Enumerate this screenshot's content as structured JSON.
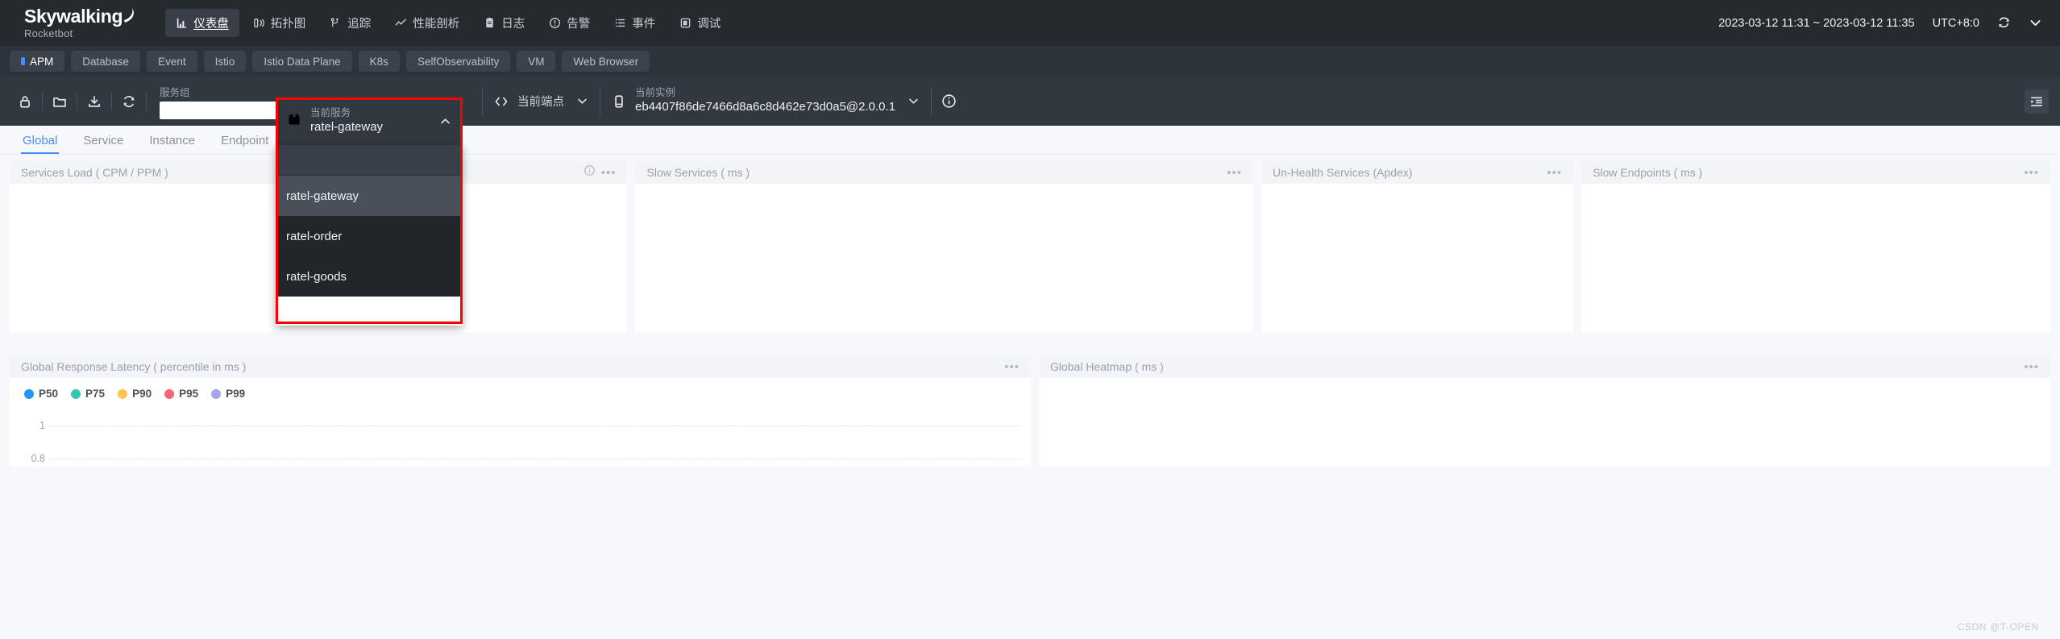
{
  "header": {
    "brand_name": "Skywalking",
    "brand_sub": "Rocketbot",
    "nav": [
      {
        "label": "仪表盘",
        "icon": "dashboard-icon",
        "active": true
      },
      {
        "label": "拓扑图",
        "icon": "topology-icon",
        "active": false
      },
      {
        "label": "追踪",
        "icon": "trace-icon",
        "active": false
      },
      {
        "label": "性能剖析",
        "icon": "profiling-icon",
        "active": false
      },
      {
        "label": "日志",
        "icon": "log-icon",
        "active": false
      },
      {
        "label": "告警",
        "icon": "alarm-icon",
        "active": false
      },
      {
        "label": "事件",
        "icon": "event-icon",
        "active": false
      },
      {
        "label": "调试",
        "icon": "debug-icon",
        "active": false
      }
    ],
    "time_range": "2023-03-12 11:31 ~ 2023-03-12 11:35",
    "timezone": "UTC+8:0",
    "reload_icon": "refresh-icon",
    "expand_icon": "chevron-down-icon"
  },
  "subnav": {
    "items": [
      {
        "label": "APM",
        "active": true
      },
      {
        "label": "Database",
        "active": false
      },
      {
        "label": "Event",
        "active": false
      },
      {
        "label": "Istio",
        "active": false
      },
      {
        "label": "Istio Data Plane",
        "active": false
      },
      {
        "label": "K8s",
        "active": false
      },
      {
        "label": "SelfObservability",
        "active": false
      },
      {
        "label": "VM",
        "active": false
      },
      {
        "label": "Web Browser",
        "active": false
      }
    ]
  },
  "toolbar": {
    "icons": [
      {
        "name": "lock-icon"
      },
      {
        "name": "folder-icon"
      },
      {
        "name": "export-icon"
      },
      {
        "name": "refresh-icon"
      }
    ],
    "service_group": {
      "label": "服务组",
      "value": "",
      "placeholder": ""
    },
    "service_selector": {
      "icon": "service-icon",
      "label": "当前服务",
      "value": "ratel-gateway",
      "caret": "chevron-up-icon",
      "open": true,
      "search_value": "",
      "options": [
        {
          "label": "ratel-gateway",
          "selected": true
        },
        {
          "label": "ratel-order",
          "selected": false
        },
        {
          "label": "ratel-goods",
          "selected": false
        }
      ]
    },
    "endpoint_selector": {
      "icon": "code-icon",
      "label": "当前端点",
      "caret": "chevron-down-icon"
    },
    "instance_selector": {
      "icon": "instance-icon",
      "label": "当前实例",
      "value": "eb4407f86de7466d8a6c8d462e73d0a5@2.0.0.1",
      "caret": "chevron-down-icon"
    },
    "info_icon": "info-icon",
    "collapse_icon": "collapse-panel-icon"
  },
  "tabs": {
    "items": [
      {
        "label": "Global",
        "active": true
      },
      {
        "label": "Service",
        "active": false
      },
      {
        "label": "Instance",
        "active": false
      },
      {
        "label": "Endpoint",
        "active": false
      }
    ]
  },
  "dashboard": {
    "row1": [
      {
        "title": "Services Load ( CPM / PPM )",
        "has_info": true,
        "menu": "•••"
      },
      {
        "title": "Slow Services ( ms )",
        "has_info": false,
        "menu": "•••"
      },
      {
        "title": "Un-Health Services (Apdex)",
        "has_info": false,
        "menu": "•••"
      },
      {
        "title": "Slow Endpoints ( ms )",
        "has_info": false,
        "menu": "•••"
      }
    ],
    "row2": [
      {
        "title": "Global Response Latency ( percentile in ms )",
        "menu": "•••"
      },
      {
        "title": "Global Heatmap ( ms )",
        "menu": "•••"
      }
    ]
  },
  "chart_data": {
    "type": "line",
    "title": "Global Response Latency ( percentile in ms )",
    "xlabel": "",
    "ylabel": "",
    "grid": true,
    "legend_position": "top-left",
    "yticks": [
      "1",
      "0.8"
    ],
    "series": [
      {
        "name": "P50",
        "color": "#2196f3",
        "values": []
      },
      {
        "name": "P75",
        "color": "#35c5b0",
        "values": []
      },
      {
        "name": "P90",
        "color": "#fbc64f",
        "values": []
      },
      {
        "name": "P95",
        "color": "#fb6272",
        "values": []
      },
      {
        "name": "P99",
        "color": "#a4a4f0",
        "values": []
      }
    ]
  },
  "watermark": "CSDN @T-OPEN",
  "colors": {
    "accent": "#448dfe",
    "highlight_border": "#fa0000",
    "header_bg": "#252a2f",
    "subnav_bg": "#2d333b",
    "toolbar_bg": "#32383f"
  }
}
